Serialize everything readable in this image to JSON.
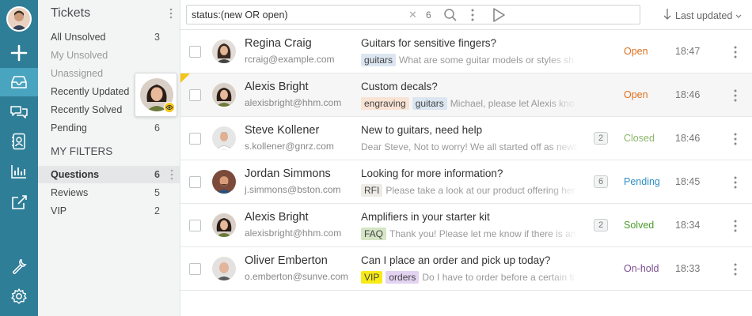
{
  "rail": {
    "icons": [
      "avatar",
      "plus-icon",
      "inbox-icon",
      "chat-icon",
      "contacts-icon",
      "reports-icon",
      "external-link-icon",
      "wrench-icon",
      "settings-icon"
    ],
    "active": "inbox-icon",
    "color": "#2f7e97",
    "active_color": "#49a4c0"
  },
  "sidebar": {
    "title": "Tickets",
    "views": [
      {
        "label": "All Unsolved",
        "count": "3"
      },
      {
        "label": "My Unsolved",
        "count": ""
      },
      {
        "label": "Unassigned",
        "count": ""
      },
      {
        "label": "Recently Updated",
        "count": ""
      },
      {
        "label": "Recently Solved",
        "count": ""
      },
      {
        "label": "Pending",
        "count": "6"
      }
    ],
    "filters_heading": "MY FILTERS",
    "filters": [
      {
        "label": "Questions",
        "count": "6"
      },
      {
        "label": "Reviews",
        "count": "5"
      },
      {
        "label": "VIP",
        "count": "2"
      }
    ]
  },
  "search": {
    "query": "status:(new OR open)",
    "result_count": "6",
    "sort_label": "Last updated"
  },
  "tickets": [
    {
      "name": "Regina Craig",
      "email": "rcraig@example.com",
      "subject": "Guitars for sensitive fingers?",
      "tags": [
        {
          "text": "guitars",
          "color": "#dbe6f1"
        }
      ],
      "preview": "What are some guitar models or styles sh",
      "count": "",
      "status": "Open",
      "status_color": "#e0701e",
      "time": "18:47"
    },
    {
      "name": "Alexis Bright",
      "email": "alexisbright@hhm.com",
      "subject": "Custom decals?",
      "tags": [
        {
          "text": "engraving",
          "color": "#f9e3d4"
        },
        {
          "text": "guitars",
          "color": "#dbe6f1"
        }
      ],
      "preview": "Michael, please let Alexis kno",
      "count": "",
      "status": "Open",
      "status_color": "#e0701e",
      "time": "18:46"
    },
    {
      "name": "Steve Kollener",
      "email": "s.kollener@gnrz.com",
      "subject": "New to guitars, need help",
      "tags": [],
      "preview": "Dear Steve, Not to worry! We all started off as newb",
      "count": "2",
      "status": "Closed",
      "status_color": "#8ab56a",
      "time": "18:46"
    },
    {
      "name": "Jordan Simmons",
      "email": "j.simmons@bston.com",
      "subject": "Looking for more information?",
      "tags": [
        {
          "text": "RFI",
          "color": "#eeece6"
        }
      ],
      "preview": "Please take a look at our product offering her",
      "count": "6",
      "status": "Pending",
      "status_color": "#2f8fc4",
      "time": "18:45"
    },
    {
      "name": "Alexis Bright",
      "email": "alexisbright@hhm.com",
      "subject": "Amplifiers in your starter kit",
      "tags": [
        {
          "text": "FAQ",
          "color": "#d5e6c6"
        }
      ],
      "preview": "Thank you! Please let me know if there is an",
      "count": "2",
      "status": "Solved",
      "status_color": "#4a9b2c",
      "time": "18:34"
    },
    {
      "name": "Oliver Emberton",
      "email": "o.emberton@sunve.com",
      "subject": "Can I place an order and pick up today?",
      "tags": [
        {
          "text": "VIP",
          "color": "#f7ea17"
        },
        {
          "text": "orders",
          "color": "#e3d3f1"
        }
      ],
      "preview": "Do I have to order before a certain ti",
      "count": "",
      "status": "On-hold",
      "status_color": "#7c4f8f",
      "time": "18:33"
    }
  ]
}
